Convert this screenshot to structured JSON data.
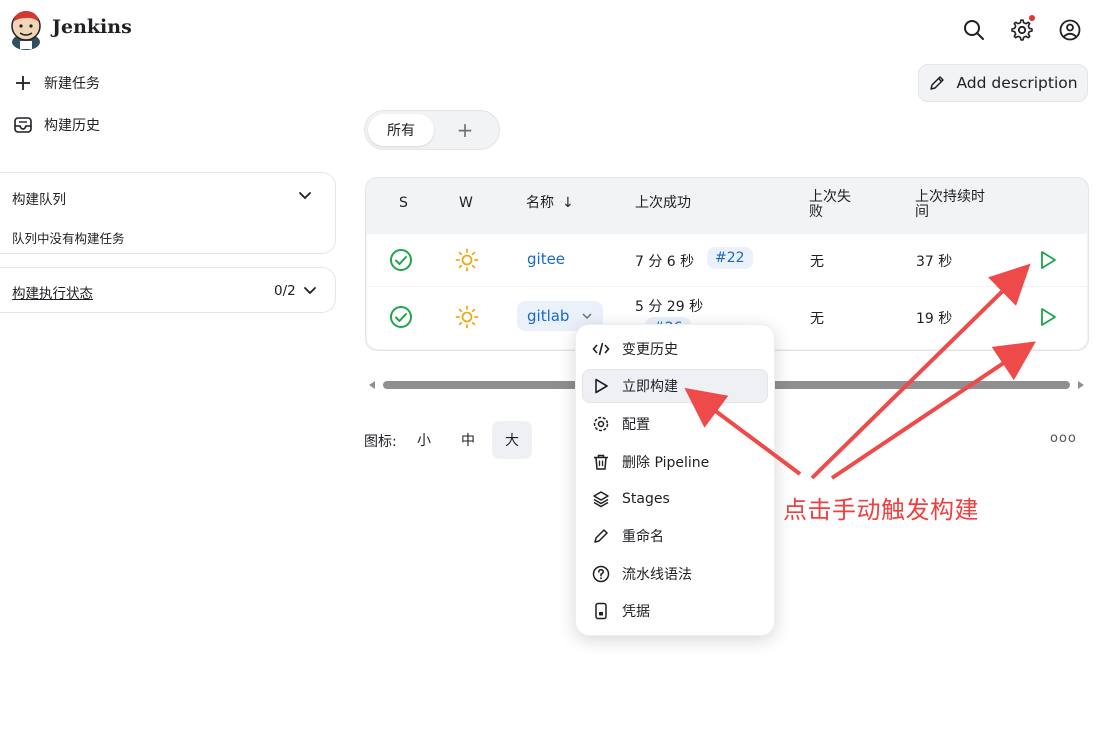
{
  "header": {
    "brand": "Jenkins",
    "icons": [
      "search-icon",
      "gear-icon",
      "user-icon"
    ],
    "notification_color": "#e5342c"
  },
  "sidebar": {
    "links": [
      {
        "label": "新建任务",
        "icon": "plus-icon"
      },
      {
        "label": "构建历史",
        "icon": "inbox-icon"
      }
    ],
    "queue": {
      "title": "构建队列",
      "empty": "队列中没有构建任务"
    },
    "executors": {
      "title": "构建执行状态",
      "count": "0/2"
    }
  },
  "main": {
    "add_description": "Add description",
    "tabs": [
      {
        "label": "所有"
      },
      {
        "label": "+"
      }
    ],
    "table": {
      "headers": {
        "s": "S",
        "w": "W",
        "name": "名称",
        "sort": "↓",
        "last_success": "上次成功",
        "last_failure_1": "上次失",
        "last_failure_2": "败",
        "last_duration_1": "上次持续时",
        "last_duration_2": "间"
      },
      "rows": [
        {
          "name": "gitee",
          "last_success": "7 分 6 秒",
          "build": "#22",
          "last_failure": "无",
          "last_duration": "37 秒"
        },
        {
          "name": "gitlab",
          "last_success": "5 分 29 秒",
          "build": "#26",
          "last_failure": "无",
          "last_duration": "19 秒"
        }
      ]
    },
    "icon_size": {
      "label": "图标:",
      "options": [
        "小",
        "中",
        "大"
      ],
      "selected": "大"
    },
    "more": "ooo"
  },
  "menu": {
    "items": [
      {
        "label": "变更历史",
        "icon": "code-icon"
      },
      {
        "label": "立即构建",
        "icon": "play-icon"
      },
      {
        "label": "配置",
        "icon": "gear-icon"
      },
      {
        "label": "删除 Pipeline",
        "icon": "trash-icon"
      },
      {
        "label": "Stages",
        "icon": "layers-icon"
      },
      {
        "label": "重命名",
        "icon": "pencil-icon"
      },
      {
        "label": "流水线语法",
        "icon": "help-icon"
      },
      {
        "label": "凭据",
        "icon": "phone-icon"
      }
    ],
    "highlighted": "立即构建"
  },
  "annotation": {
    "text": "点击手动触发构建",
    "color": "#ef3f3f"
  },
  "colors": {
    "success": "#1ea64a",
    "link": "#1569c7",
    "sun": "#f0a81c",
    "play": "#1ea64a"
  }
}
